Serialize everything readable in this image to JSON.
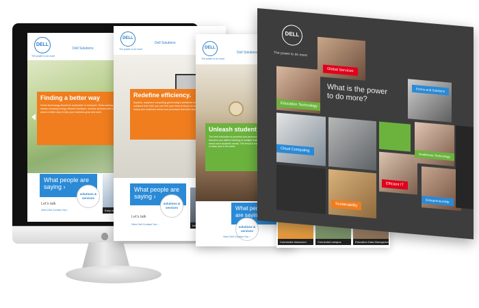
{
  "brand": {
    "logo_text": "DELL",
    "tagline": "The power to do more",
    "accent_blue": "#2a8ad6",
    "orange": "#f07e1f",
    "green": "#6cb33e"
  },
  "monitor_page": {
    "nav_label": "Dell Solutions",
    "banner_title": "Finding a better way",
    "banner_body": "Green technology should be accessible to everyone. Green saving technologies means choosing energy efficient hardware, smarter services and software... it's about a better way to help your business grow and save.",
    "people_heading": "What people are saying ›",
    "solutions_label": "solutions & services",
    "lets_talk": "Let's talk",
    "contact_link": "View Dell Contact You ›",
    "thumb_caption": "Easy recycling"
  },
  "page2": {
    "nav_label": "Dell Solutions",
    "banner_title": "Redefine efficiency.",
    "banner_body": "Anytime, anywhere computing gives today's workforce more. With efficient IT solutions from Dell, you can free your team to focus on innovative technology that keeps your business ahead and processes that drive business innovation.",
    "people_heading": "What people are saying ›",
    "solutions_label": "solutions & services",
    "lets_talk": "Let's talk",
    "contact_link": "View Dell Contact You ›",
    "thumb_caption": "Infrastructure efficiency"
  },
  "page3": {
    "nav_label": "Dell Solutions",
    "banner_title": "Unleash student potential",
    "banner_body": "The best education is powerful and personal. With the right technology, teachers can deliver learning to multiple learning styles, and dynamically reach each student's needs. The result is every student's unique potential — in class and in the world.",
    "people_heading": "What people are saying ›",
    "solutions_label": "solutions & services",
    "contact_link": "View Dell Contact You ›",
    "thumbs": [
      "Connected classroom",
      "Connected campus",
      "Education Data Management"
    ]
  },
  "tiles_page": {
    "tagline": "The power to do more",
    "hero_text": "What is the power to do more?",
    "tags": {
      "global_services": "Global Services",
      "education_technology": "Education Technology",
      "cloud_computing": "Cloud Computing",
      "end_to_end": "End-to-end Solutions",
      "healthcare": "Healthcare Technology",
      "efficient_it": "Efficient IT",
      "sustainability": "Sustainability",
      "entrepreneurship": "Entrepreneurship"
    }
  }
}
